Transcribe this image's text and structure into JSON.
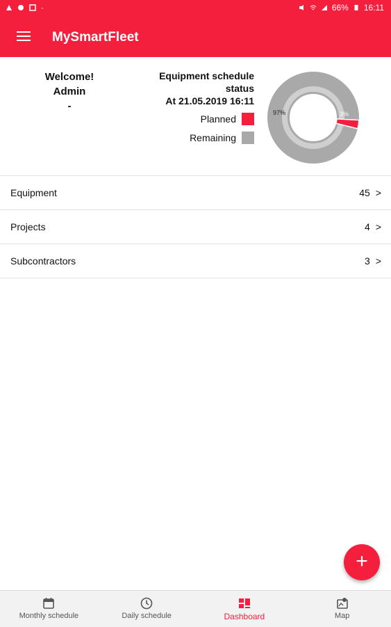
{
  "status_bar": {
    "battery": "66%",
    "time": "16:11"
  },
  "app_bar": {
    "title": "MySmartFleet",
    "menu_icon": "menu-icon"
  },
  "welcome": {
    "greeting": "Welcome!",
    "user": "Admin",
    "subtitle": "-"
  },
  "schedule_status": {
    "title_line1": "Equipment schedule",
    "title_line2": "status",
    "timestamp": "At 21.05.2019 16:11",
    "legend": [
      {
        "label": "Planned",
        "color": "#f31f3c"
      },
      {
        "label": "Remaining",
        "color": "#a9a9a9"
      }
    ],
    "donut": {
      "remaining_label": "97%",
      "planned_label": "3%",
      "planned_value": 3,
      "remaining_value": 97
    }
  },
  "list": [
    {
      "label": "Equipment",
      "count": "45",
      "chevron": ">"
    },
    {
      "label": "Projects",
      "count": "4",
      "chevron": ">"
    },
    {
      "label": "Subcontractors",
      "count": "3",
      "chevron": ">"
    }
  ],
  "fab": {
    "icon": "plus-icon",
    "label": "+"
  },
  "bottom_nav": [
    {
      "label": "Monthly schedule",
      "icon": "calendar-icon",
      "active": false
    },
    {
      "label": "Daily schedule",
      "icon": "clock-icon",
      "active": false
    },
    {
      "label": "Dashboard",
      "icon": "dashboard-icon",
      "active": true
    },
    {
      "label": "Map",
      "icon": "map-icon",
      "active": false
    }
  ],
  "colors": {
    "brand": "#f31f3c",
    "remaining": "#a9a9a9",
    "nav_bg": "#f2f2f2"
  }
}
